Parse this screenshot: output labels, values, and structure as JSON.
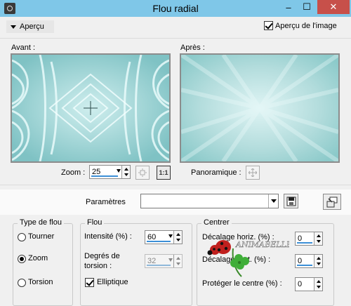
{
  "window": {
    "title": "Flou radial",
    "controls": {
      "minimize": "–",
      "maximize": "☐",
      "close": "✕"
    },
    "icon": "camera-icon"
  },
  "preview": {
    "toggle_label": "Aperçu",
    "image_preview_label": "Aperçu de l'image",
    "image_preview_checked": true,
    "before_label": "Avant :",
    "after_label": "Après :"
  },
  "zoom": {
    "label": "Zoom :",
    "value": "25",
    "fit_icon": "fit-to-window-icon",
    "one_to_one_label": "1:1",
    "pan_label": "Panoramique :",
    "pan_icon": "move-crosshair-icon"
  },
  "parameters": {
    "label": "Paramètres",
    "value": "",
    "save_icon": "save-icon",
    "import_icon": "import-presets-icon"
  },
  "blur_type": {
    "title": "Type de flou",
    "options": [
      {
        "label": "Tourner",
        "selected": false
      },
      {
        "label": "Zoom",
        "selected": true
      },
      {
        "label": "Torsion",
        "selected": false
      }
    ]
  },
  "blur": {
    "title": "Flou",
    "intensity_label": "Intensité (%) :",
    "intensity_value": "60",
    "twist_label_1": "Degrés de",
    "twist_label_2": "torsion :",
    "twist_value": "32",
    "twist_enabled": false,
    "elliptic_label": "Elliptique",
    "elliptic_checked": true
  },
  "center": {
    "title": "Centrer",
    "h_offset_label": "Décalage horiz. (%) :",
    "h_offset_value": "0",
    "v_offset_label": "Décalage vert. (%) :",
    "v_offset_value": "0",
    "protect_label": "Protéger le centre (%) :",
    "protect_value": "0"
  },
  "watermark": {
    "text": "ANIMABELLE"
  },
  "colors": {
    "titlebar": "#7fc7e8",
    "close_button": "#c7504a",
    "accent_underline": "#3c8fd6",
    "preview_teal": "#8fcaca"
  }
}
